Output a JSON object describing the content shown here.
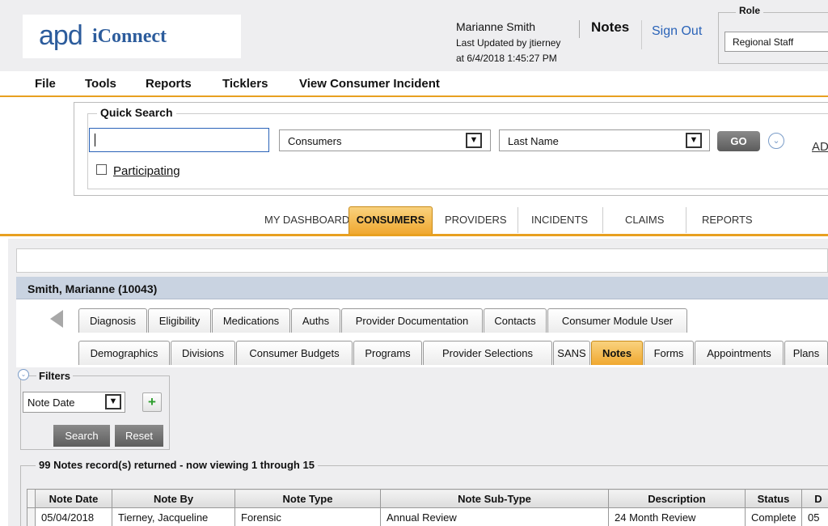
{
  "header": {
    "logo_apd": "apd",
    "logo_iconnect": "iConnect",
    "user_name": "Marianne Smith",
    "last_updated_by": "Last Updated by jtierney",
    "last_updated_at": "at 6/4/2018 1:45:27 PM",
    "notes_label": "Notes",
    "sign_out": "Sign Out",
    "role_label": "Role",
    "role_value": "Regional Staff"
  },
  "menu": {
    "items": [
      "File",
      "Tools",
      "Reports",
      "Ticklers",
      "View Consumer Incident"
    ]
  },
  "quick_search": {
    "legend": "Quick Search",
    "input_value": "",
    "type_value": "Consumers",
    "field_value": "Last Name",
    "go_label": "GO",
    "advanced_link": "AD",
    "participating_label": "Participating",
    "participating_checked": false
  },
  "main_tabs": {
    "items": [
      "MY DASHBOARD",
      "CONSUMERS",
      "PROVIDERS",
      "INCIDENTS",
      "CLAIMS",
      "REPORTS"
    ],
    "active": "CONSUMERS"
  },
  "consumer": {
    "header": "Smith, Marianne (10043)"
  },
  "sub_tabs": {
    "row1": [
      "Diagnosis",
      "Eligibility",
      "Medications",
      "Auths",
      "Provider Documentation",
      "Contacts",
      "Consumer Module User"
    ],
    "row2": [
      "Demographics",
      "Divisions",
      "Consumer Budgets",
      "Programs",
      "Provider Selections",
      "SANS",
      "Notes",
      "Forms",
      "Appointments",
      "Plans"
    ],
    "active": "Notes"
  },
  "filters": {
    "legend": "Filters",
    "select_value": "Note Date",
    "add_label": "+",
    "search_label": "Search",
    "reset_label": "Reset"
  },
  "results": {
    "legend": "99 Notes record(s) returned - now viewing 1 through 15",
    "columns": [
      "Note Date",
      "Note By",
      "Note Type",
      "Note Sub-Type",
      "Description",
      "Status",
      "D"
    ],
    "rows": [
      [
        "05/04/2018",
        "Tierney, Jacqueline",
        "Forensic",
        "Annual Review",
        "24 Month Review",
        "Complete",
        "05"
      ]
    ]
  },
  "colors": {
    "accent_orange": "#f0a830",
    "link_blue": "#2a63b8",
    "header_bg": "#eeeef0",
    "consumer_header_bg": "#c9d3e1"
  }
}
